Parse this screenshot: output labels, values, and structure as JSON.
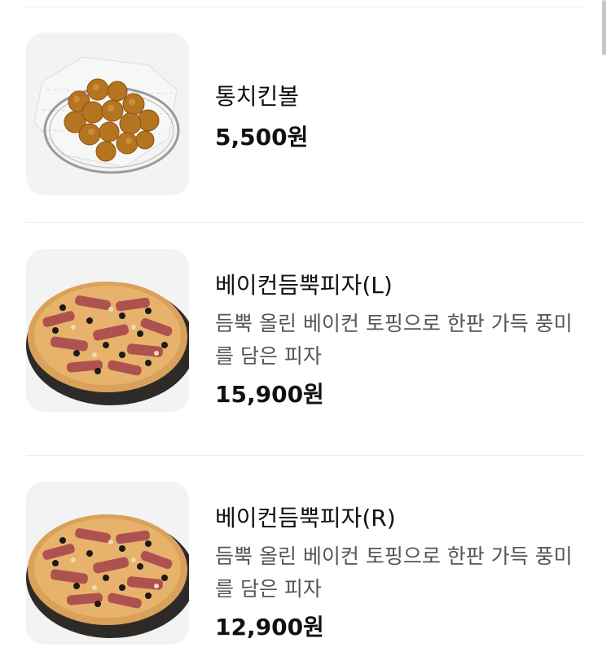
{
  "menu_items": [
    {
      "name": "통치킨볼",
      "description": "",
      "price": "5,500원",
      "image_icon": "chicken-ball-image"
    },
    {
      "name": "베이컨듬뿍피자(L)",
      "description": "듬뿍 올린 베이컨 토핑으로 한판 가득 풍미를 담은 피자",
      "price": "15,900원",
      "image_icon": "bacon-pizza-image"
    },
    {
      "name": "베이컨듬뿍피자(R)",
      "description": "듬뿍 올린 베이컨 토핑으로 한판 가득 풍미를 담은 피자",
      "price": "12,900원",
      "image_icon": "bacon-pizza-image"
    }
  ],
  "colors": {
    "text_primary": "#111111",
    "text_secondary": "#555555",
    "divider": "#ececec",
    "thumb_bg": "#f3f3f3"
  }
}
